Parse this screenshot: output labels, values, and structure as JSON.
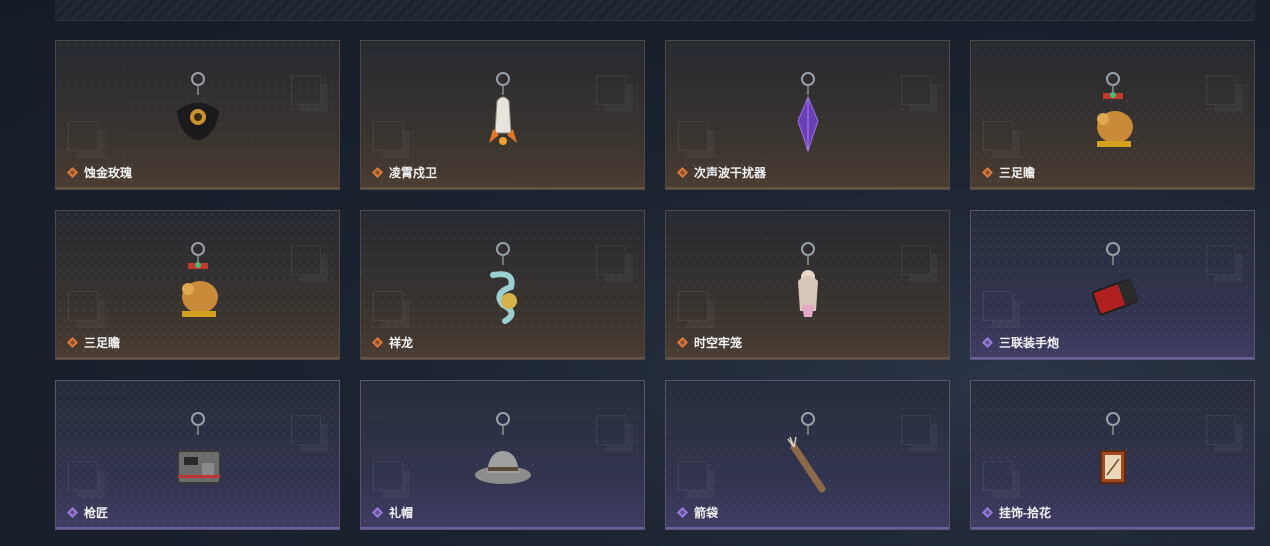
{
  "colors": {
    "orange": "#e07a3a",
    "purple": "#9a7ce0",
    "mint": "#3fd6a0"
  },
  "items": [
    {
      "name": "蚀金玫瑰",
      "rarity": "orange",
      "icon": "black-rose-charm-icon"
    },
    {
      "name": "凌霄戍卫",
      "rarity": "orange",
      "icon": "rocket-charm-icon"
    },
    {
      "name": "次声波干扰器",
      "rarity": "orange",
      "icon": "purple-crystal-charm-icon"
    },
    {
      "name": "三足瞻",
      "rarity": "orange",
      "icon": "golden-toad-charm-icon"
    },
    {
      "name": "三足瞻",
      "rarity": "orange",
      "icon": "golden-toad-charm-icon"
    },
    {
      "name": "祥龙",
      "rarity": "orange",
      "icon": "dragon-charm-icon"
    },
    {
      "name": "时空牢笼",
      "rarity": "orange",
      "icon": "doll-charm-icon"
    },
    {
      "name": "三联装手炮",
      "rarity": "purple",
      "icon": "hand-cannon-charm-icon"
    },
    {
      "name": "枪匠",
      "rarity": "purple",
      "icon": "toolbox-charm-icon"
    },
    {
      "name": "礼帽",
      "rarity": "purple",
      "icon": "hat-charm-icon"
    },
    {
      "name": "箭袋",
      "rarity": "purple",
      "icon": "quiver-charm-icon"
    },
    {
      "name": "挂饰-拾花",
      "rarity": "purple",
      "icon": "flower-frame-charm-icon"
    }
  ]
}
